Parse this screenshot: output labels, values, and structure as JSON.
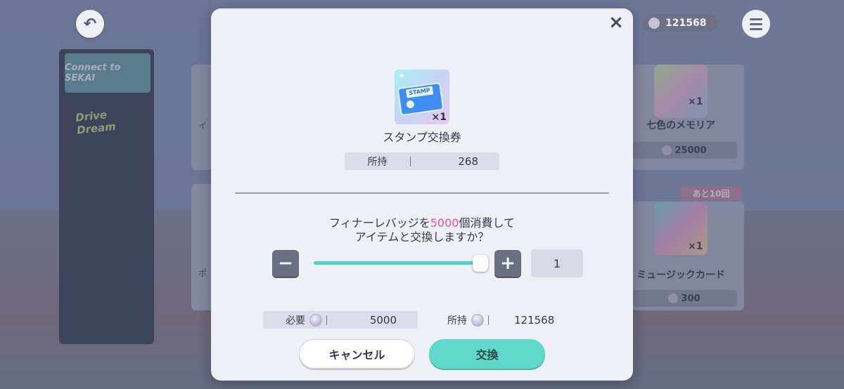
{
  "header": {
    "coin_balance": "121568"
  },
  "background": {
    "left_fragments": [
      "イ",
      "ポ"
    ],
    "banner1_text": "Connect to SEKAI",
    "banner2_text": "Drive Dream",
    "cards": [
      {
        "name": "七色のメモリア",
        "multiplier": "×1",
        "price": "25000"
      },
      {
        "name": "ミュージックカード",
        "multiplier": "×1",
        "price": "300",
        "limit_badge": "あと10回"
      }
    ]
  },
  "modal": {
    "item": {
      "icon_text": "STAMP",
      "quantity": "×1",
      "name": "スタンプ交換券"
    },
    "owned": {
      "label": "所持",
      "value": "268"
    },
    "question": {
      "before": "フィナーレバッジを",
      "amount": "5000",
      "after": "個消費して",
      "line2": "アイテムと交換しますか？"
    },
    "stepper": {
      "minus": "−",
      "plus": "+",
      "value": "1"
    },
    "slider": {
      "fraction": 1.0
    },
    "cost": {
      "required_label": "必要",
      "required_value": "5000",
      "have_label": "所持",
      "have_value": "121568"
    },
    "buttons": {
      "cancel": "キャンセル",
      "exchange": "交換"
    },
    "close": "×"
  },
  "colors": {
    "accent_teal": "#5ed9c9",
    "highlight_pink": "#e8529a",
    "modal_bg": "#efeff6"
  }
}
